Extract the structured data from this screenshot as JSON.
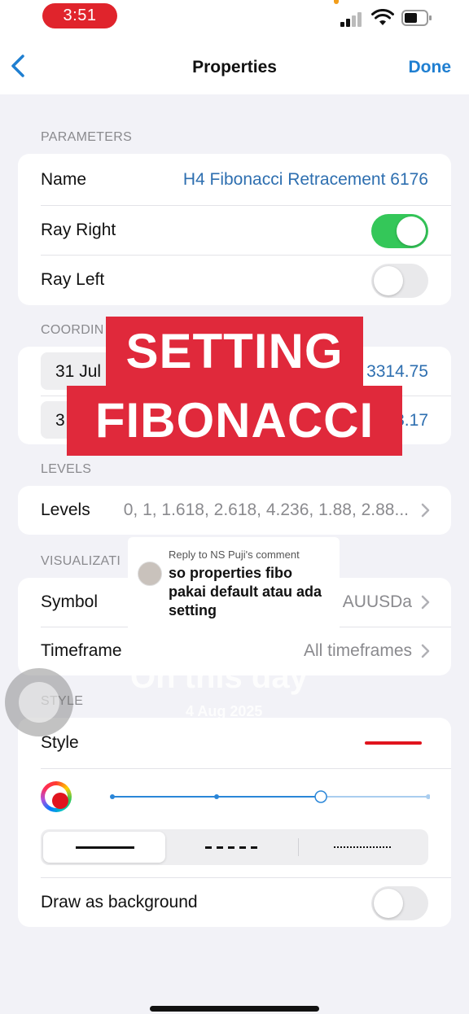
{
  "status_bar": {
    "time": "3:51",
    "battery_level": 0.6
  },
  "nav": {
    "back_label": "",
    "title": "Properties",
    "done_label": "Done"
  },
  "parameters": {
    "header": "PARAMETERS",
    "name_label": "Name",
    "name_value": "H4 Fibonacci Retracement 6176",
    "ray_right_label": "Ray Right",
    "ray_right_on": true,
    "ray_left_label": "Ray Left",
    "ray_left_on": false
  },
  "coordinates": {
    "header": "COORDIN",
    "point1_date": "31 Jul",
    "point1_price": "3314.75",
    "point2_date": "3",
    "point2_price": "3.17"
  },
  "levels": {
    "header": "LEVELS",
    "label": "Levels",
    "value": "0, 1, 1.618, 2.618, 4.236, 1.88, 2.88..."
  },
  "visualization": {
    "header": "VISUALIZATI",
    "symbol_label": "Symbol",
    "symbol_value": "AUUSDa",
    "timeframe_label": "Timeframe",
    "timeframe_value": "All timeframes"
  },
  "style": {
    "header": "STYLE",
    "label": "Style",
    "line_color": "#e0141e",
    "width_level": 0.66,
    "line_styles": [
      "solid",
      "dashed",
      "dotted"
    ],
    "selected_style": "solid",
    "draw_bg_label": "Draw as background",
    "draw_bg_on": false
  },
  "overlay": {
    "banner_line1": "SETTING",
    "banner_line2": "FIBONACCI",
    "banner_color": "#e0293b",
    "comment_meta": "Reply to NS Puji's comment",
    "comment_text": "so properties fibo pakai default atau ada setting",
    "ghost_line1": "On this day",
    "ghost_line2": "4 Aug 2025"
  },
  "colors": {
    "accent": "#1f7fd1",
    "toggle_on": "#34c759",
    "status_pill": "#e0242c"
  }
}
